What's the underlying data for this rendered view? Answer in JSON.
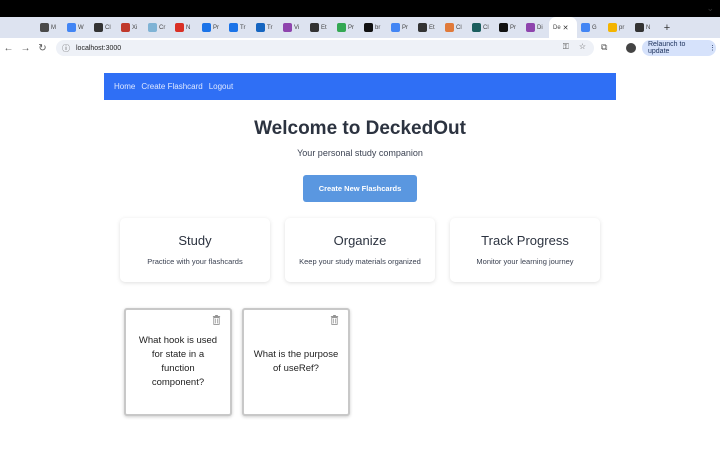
{
  "browser": {
    "tabs": [
      {
        "label": "M",
        "color": "#4a4a4a"
      },
      {
        "label": "W",
        "color": "#4285f4"
      },
      {
        "label": "Cl",
        "color": "#333333"
      },
      {
        "label": "Xi",
        "color": "#c0392b"
      },
      {
        "label": "Cr",
        "color": "#7fb3d5"
      },
      {
        "label": "N",
        "color": "#d93025"
      },
      {
        "label": "Pr",
        "color": "#1a73e8"
      },
      {
        "label": "Tr",
        "color": "#1a73e8"
      },
      {
        "label": "Tr",
        "color": "#1565c0"
      },
      {
        "label": "Vi",
        "color": "#8e44ad"
      },
      {
        "label": "Et",
        "color": "#333333"
      },
      {
        "label": "Pr",
        "color": "#34a853"
      },
      {
        "label": "br",
        "color": "#111111"
      },
      {
        "label": "Pr",
        "color": "#4285f4"
      },
      {
        "label": "Et",
        "color": "#333333"
      },
      {
        "label": "Cl",
        "color": "#e07a3a"
      },
      {
        "label": "Cl",
        "color": "#1b5e5e"
      },
      {
        "label": "Pr",
        "color": "#111111"
      },
      {
        "label": "Di",
        "color": "#8e44ad"
      }
    ],
    "active_tab": {
      "label": "De"
    },
    "extra_tabs": [
      {
        "label": "G",
        "color": "#4285f4"
      },
      {
        "label": "pr",
        "color": "#f4b400"
      },
      {
        "label": "N",
        "color": "#333333"
      }
    ],
    "url": "localhost:3000",
    "relaunch_label": "Relaunch to update"
  },
  "nav": {
    "links": [
      "Home",
      "Create Flashcard",
      "Logout"
    ]
  },
  "hero": {
    "title": "Welcome to DeckedOut",
    "subtitle": "Your personal study companion",
    "cta_label": "Create New Flashcards"
  },
  "features": [
    {
      "title": "Study",
      "text": "Practice with your flashcards"
    },
    {
      "title": "Organize",
      "text": "Keep your study materials organized"
    },
    {
      "title": "Track Progress",
      "text": "Monitor your learning journey"
    }
  ],
  "flashcards": [
    {
      "question": "What hook is used for state in a function component?"
    },
    {
      "question": "What is the purpose of useRef?"
    }
  ]
}
